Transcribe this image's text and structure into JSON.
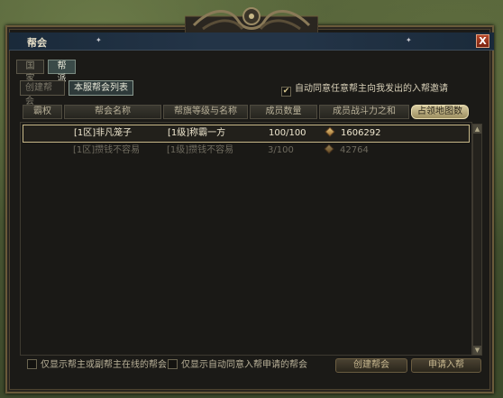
{
  "window": {
    "title": "帮会",
    "close_glyph": "X"
  },
  "tabs": [
    {
      "label": "国家",
      "active": false
    },
    {
      "label": "帮派",
      "active": true
    }
  ],
  "subtabs": [
    {
      "label": "创建帮会",
      "active": false
    },
    {
      "label": "本服帮会列表",
      "active": true
    }
  ],
  "auto_accept": {
    "label": "自动同意任意帮主向我发出的入帮邀请",
    "checked": true
  },
  "table": {
    "headers": [
      "霸权",
      "帮会名称",
      "帮旗等级与名称",
      "成员数量",
      "成员战斗力之和",
      "占领地图数"
    ],
    "rows": [
      {
        "name": "[1区]非凡笼子",
        "flag": "[1级]称霸一方",
        "members": "100/100",
        "power": "1606292",
        "selected": true
      },
      {
        "name": "[1区]攒钱不容易",
        "flag": "[1级]攒钱不容易",
        "members": "3/100",
        "power": "42764",
        "selected": false
      }
    ]
  },
  "filters": [
    {
      "label": "仅显示帮主或副帮主在线的帮会",
      "checked": false
    },
    {
      "label": "仅显示自动同意入帮申请的帮会",
      "checked": false
    }
  ],
  "buttons": {
    "create": "创建帮会",
    "apply": "申请入帮"
  },
  "colors": {
    "frame": "#6a5a3a",
    "titlebar": "#233447",
    "selected_border": "#c8b888",
    "highlight_header": "#d8cca0"
  }
}
